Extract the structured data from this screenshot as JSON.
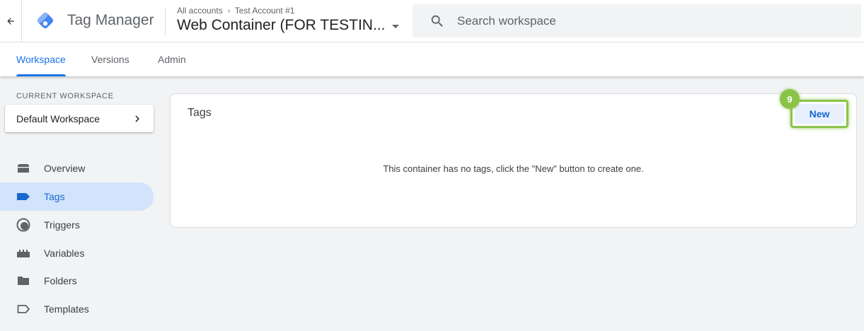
{
  "header": {
    "app_name": "Tag Manager",
    "breadcrumb": [
      "All accounts",
      "Test Account #1"
    ],
    "container_name": "Web Container (FOR TESTIN...",
    "search_placeholder": "Search workspace"
  },
  "tabs": [
    {
      "label": "Workspace",
      "active": true
    },
    {
      "label": "Versions",
      "active": false
    },
    {
      "label": "Admin",
      "active": false
    }
  ],
  "sidebar": {
    "workspace_label": "CURRENT WORKSPACE",
    "workspace_name": "Default Workspace",
    "items": [
      {
        "label": "Overview",
        "icon": "overview-icon",
        "active": false
      },
      {
        "label": "Tags",
        "icon": "tag-icon",
        "active": true
      },
      {
        "label": "Triggers",
        "icon": "trigger-icon",
        "active": false
      },
      {
        "label": "Variables",
        "icon": "variables-icon",
        "active": false
      },
      {
        "label": "Folders",
        "icon": "folder-icon",
        "active": false
      },
      {
        "label": "Templates",
        "icon": "template-icon",
        "active": false
      }
    ]
  },
  "main": {
    "title": "Tags",
    "new_button": "New",
    "step_badge": "9",
    "empty_message": "This container has no tags, click the \"New\" button to create one."
  },
  "colors": {
    "accent": "#1a73e8",
    "active_nav_bg": "#d2e3fc",
    "highlight": "#8bc34a",
    "logo_blue": "#4285f4",
    "logo_light": "#8ab4f8"
  }
}
